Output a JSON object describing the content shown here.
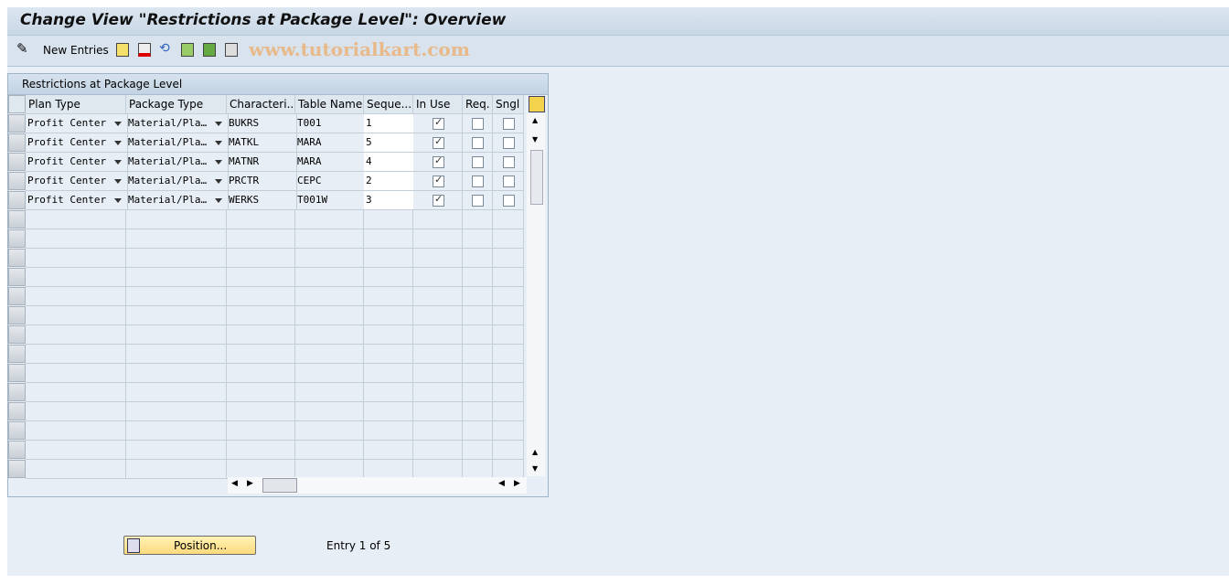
{
  "title": "Change View \"Restrictions at Package Level\": Overview",
  "toolbar": {
    "new_entries": "New Entries",
    "watermark": "www.tutorialkart.com"
  },
  "table": {
    "title": "Restrictions at Package Level",
    "columns": [
      "Plan Type",
      "Package Type",
      "Characteri...",
      "Table Name",
      "Seque...",
      "In Use",
      "Req.",
      "Sngl"
    ],
    "rows": [
      {
        "plan": "Profit Center",
        "pkg": "Material/Pla…",
        "char": "BUKRS",
        "table": "T001",
        "seq": "1",
        "inuse": true,
        "req": false,
        "sngl": false
      },
      {
        "plan": "Profit Center",
        "pkg": "Material/Pla…",
        "char": "MATKL",
        "table": "MARA",
        "seq": "5",
        "inuse": true,
        "req": false,
        "sngl": false
      },
      {
        "plan": "Profit Center",
        "pkg": "Material/Pla…",
        "char": "MATNR",
        "table": "MARA",
        "seq": "4",
        "inuse": true,
        "req": false,
        "sngl": false
      },
      {
        "plan": "Profit Center",
        "pkg": "Material/Pla…",
        "char": "PRCTR",
        "table": "CEPC",
        "seq": "2",
        "inuse": true,
        "req": false,
        "sngl": false
      },
      {
        "plan": "Profit Center",
        "pkg": "Material/Pla…",
        "char": "WERKS",
        "table": "T001W",
        "seq": "3",
        "inuse": true,
        "req": false,
        "sngl": false
      }
    ]
  },
  "footer": {
    "position_button": "Position...",
    "entry_text": "Entry 1 of 5"
  }
}
